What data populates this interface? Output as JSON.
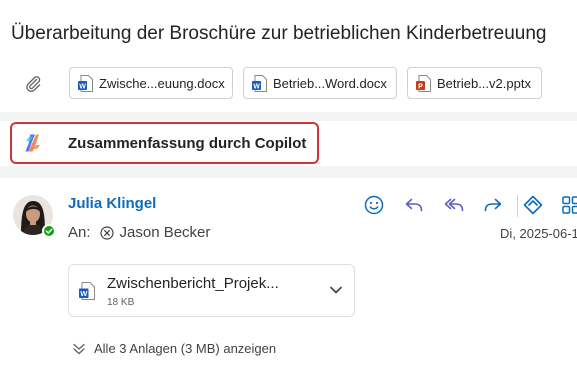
{
  "subject": "Überarbeitung der Broschüre zur betrieblichen Kinderbetreuung",
  "attachments": [
    {
      "name": "Zwische...euung.docx",
      "type": "word",
      "icon": "word-file-icon"
    },
    {
      "name": "Betrieb...Word.docx",
      "type": "word",
      "icon": "word-file-icon"
    },
    {
      "name": "Betrieb...v2.pptx",
      "type": "powerpoint",
      "icon": "powerpoint-file-icon"
    }
  ],
  "copilot": {
    "label": "Zusammenfassung durch Copilot",
    "icon": "copilot-icon"
  },
  "message": {
    "sender": "Julia Klingel",
    "to_label": "An:",
    "recipient": "Jason Becker",
    "date": "Di, 2025-06-1",
    "presence": "available"
  },
  "file_card": {
    "name": "Zwischenbericht_Projek...",
    "size": "18 KB"
  },
  "show_all": "Alle 3 Anlagen (3 MB) anzeigen",
  "colors": {
    "accent": "#0f6cbd",
    "action_purple": "#5b5fc7",
    "word": "#185abd",
    "powerpoint": "#c43e1c",
    "copilot_border": "#d13438",
    "presence": "#13a10e"
  }
}
